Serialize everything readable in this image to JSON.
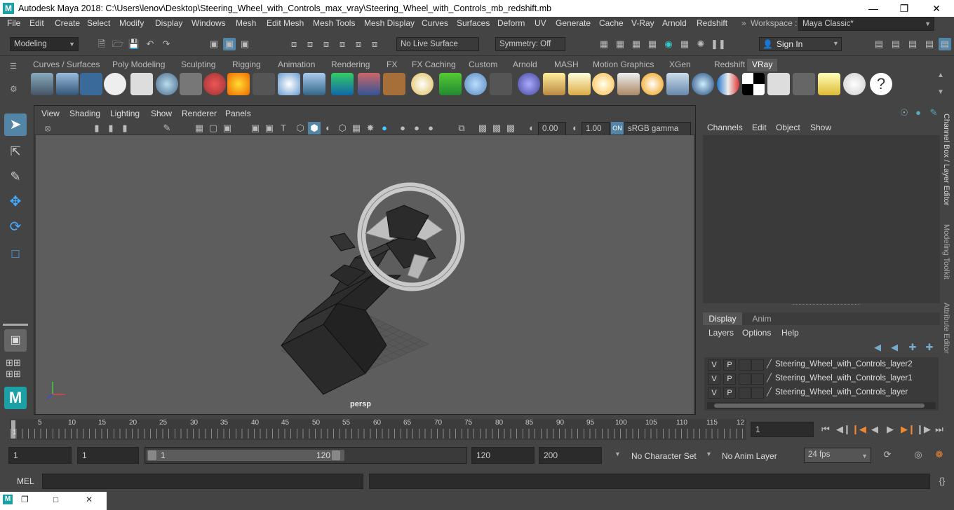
{
  "window": {
    "title": "Autodesk Maya 2018: C:\\Users\\lenov\\Desktop\\Steering_Wheel_with_Controls_max_vray\\Steering_Wheel_with_Controls_mb_redshift.mb",
    "logo": "M"
  },
  "menus": [
    "File",
    "Edit",
    "Create",
    "Select",
    "Modify",
    "Display",
    "Windows",
    "Mesh",
    "Edit Mesh",
    "Mesh Tools",
    "Mesh Display",
    "Curves",
    "Surfaces",
    "Deform",
    "UV",
    "Generate",
    "Cache",
    "V-Ray",
    "Arnold",
    "Redshift"
  ],
  "workspace": {
    "label": "Workspace :",
    "value": "Maya Classic*"
  },
  "statusline": {
    "mode": "Modeling",
    "live_surface": "No Live Surface",
    "symmetry": "Symmetry: Off",
    "sign_in": "Sign In"
  },
  "shelf_tabs": [
    "Curves / Surfaces",
    "Poly Modeling",
    "Sculpting",
    "Rigging",
    "Animation",
    "Rendering",
    "FX",
    "FX Caching",
    "Custom",
    "Arnold",
    "MASH",
    "Motion Graphics",
    "XGen",
    "Redshift",
    "VRay"
  ],
  "active_shelf": "VRay",
  "panel_menus": [
    "View",
    "Shading",
    "Lighting",
    "Show",
    "Renderer",
    "Panels"
  ],
  "panel_bar": {
    "exposure": "0.00",
    "gamma": "1.00",
    "colorspace": "sRGB gamma"
  },
  "viewport": {
    "camera": "persp"
  },
  "channel_box": {
    "menus": [
      "Channels",
      "Edit",
      "Object",
      "Show"
    ]
  },
  "layer_editor": {
    "tabs": [
      "Display",
      "Anim"
    ],
    "menus": [
      "Layers",
      "Options",
      "Help"
    ],
    "layers": [
      {
        "v": "V",
        "p": "P",
        "name": "Steering_Wheel_with_Controls_layer2"
      },
      {
        "v": "V",
        "p": "P",
        "name": "Steering_Wheel_with_Controls_layer1"
      },
      {
        "v": "V",
        "p": "P",
        "name": "Steering_Wheel_with_Controls_layer"
      }
    ]
  },
  "side_tabs": [
    "Channel Box / Layer Editor",
    "Modeling Toolkit",
    "Attribute Editor"
  ],
  "timeslider": {
    "ticks": [
      "1",
      "5",
      "10",
      "15",
      "20",
      "25",
      "30",
      "35",
      "40",
      "45",
      "50",
      "55",
      "60",
      "65",
      "70",
      "75",
      "80",
      "85",
      "90",
      "95",
      "100",
      "105",
      "110",
      "115",
      "12"
    ],
    "current_frame": "1"
  },
  "range": {
    "start": "1",
    "current_start": "1",
    "slider_start": "1",
    "slider_end": "120",
    "end": "120",
    "anim_end": "200",
    "character_set": "No Character Set",
    "anim_layer": "No Anim Layer",
    "fps": "24 fps"
  },
  "cmdline": {
    "label": "MEL"
  }
}
